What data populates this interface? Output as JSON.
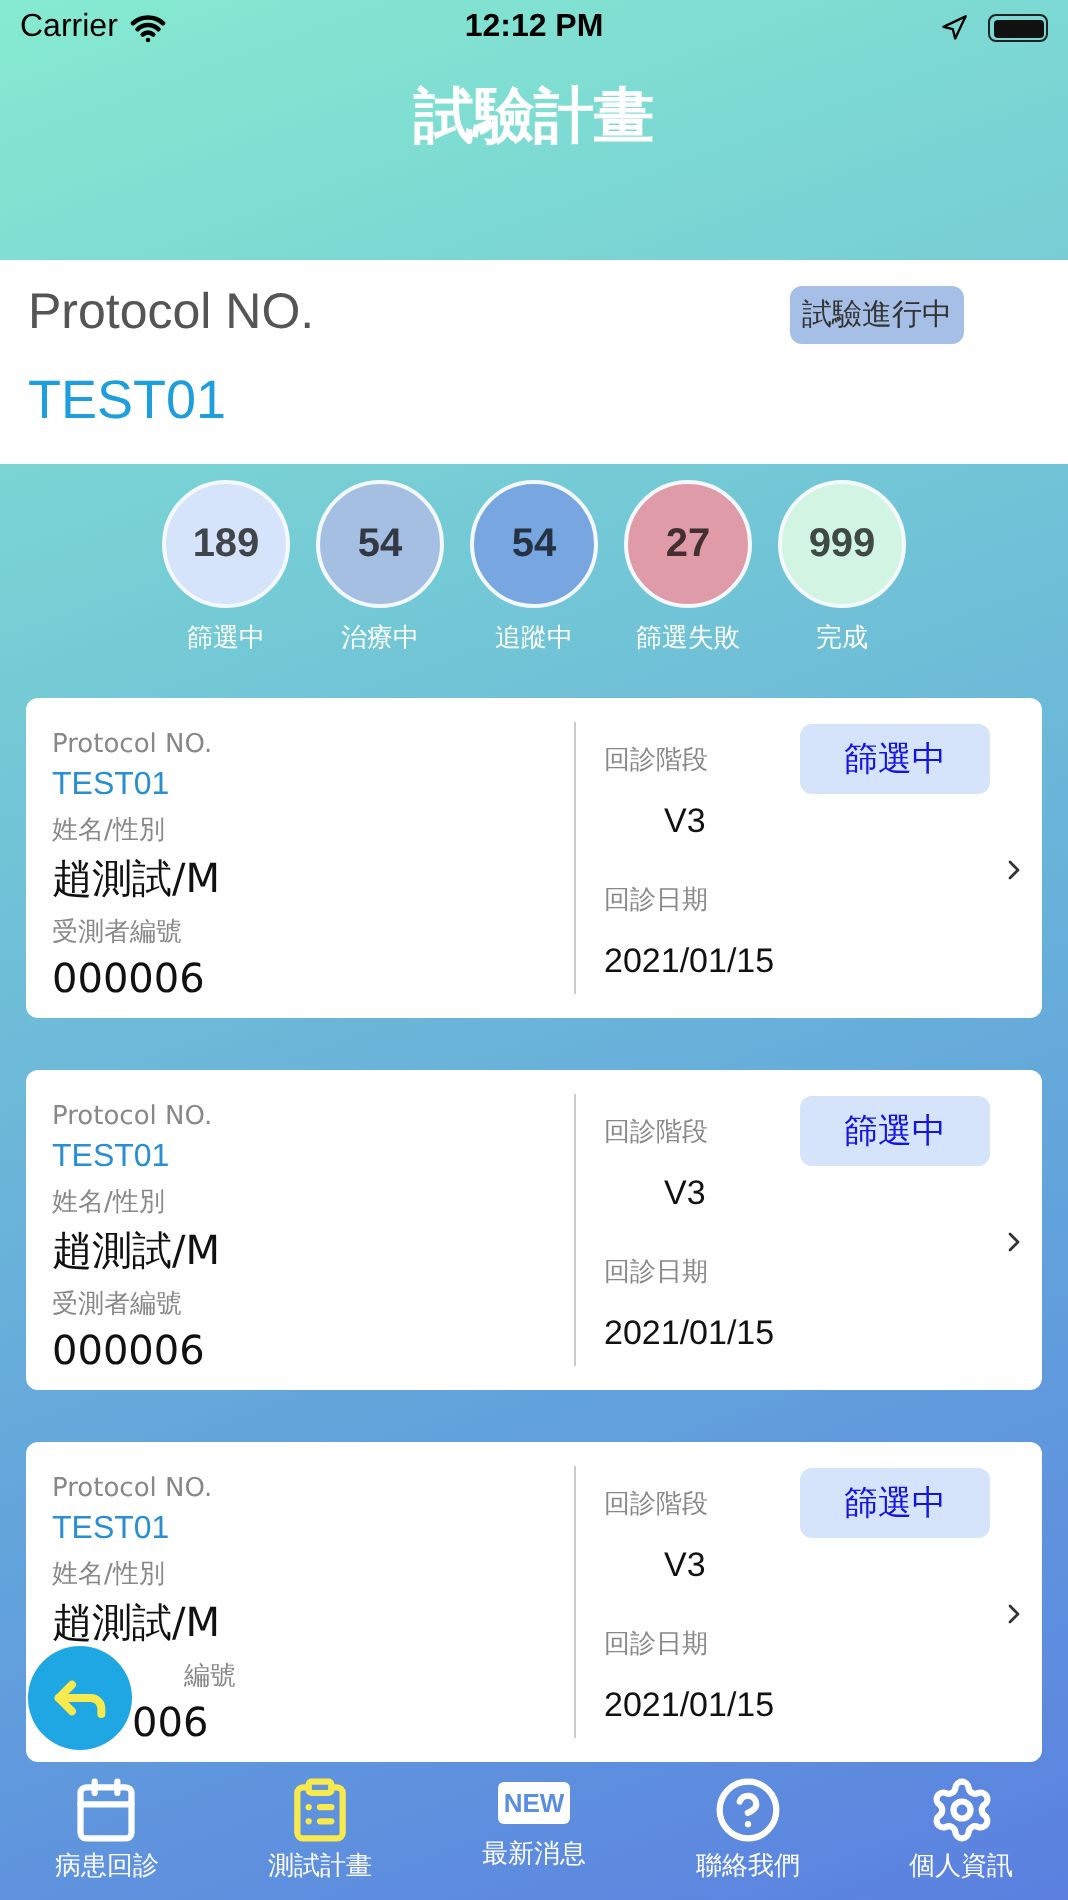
{
  "status_bar": {
    "carrier": "Carrier",
    "time": "12:12 PM"
  },
  "title": "試驗計畫",
  "protocol": {
    "label": "Protocol NO.",
    "value": "TEST01",
    "status": "試驗進行中"
  },
  "counters": [
    {
      "count": "189",
      "label": "篩選中",
      "color": "#d6e4fb"
    },
    {
      "count": "54",
      "label": "治療中",
      "color": "#a5bfe3"
    },
    {
      "count": "54",
      "label": "追蹤中",
      "color": "#77a6e0"
    },
    {
      "count": "27",
      "label": "篩選失敗",
      "color": "#e09ba8"
    },
    {
      "count": "999",
      "label": "完成",
      "color": "#d2f5e3"
    }
  ],
  "cards": [
    {
      "kind": "full",
      "protocol_label": "Protocol NO.",
      "protocol": "TEST01",
      "name_label": "姓名/性別",
      "name": "趙測試/M",
      "id_label": "受測者編號",
      "id": "000006",
      "stage_label": "回診階段",
      "stage": "V3",
      "date_label": "回診日期",
      "date": "2021/01/15",
      "status": "篩選中"
    },
    {
      "kind": "full",
      "protocol_label": "Protocol NO.",
      "protocol": "TEST01",
      "name_label": "姓名/性別",
      "name": "趙測試/M",
      "id_label": "受測者編號",
      "id": "000006",
      "stage_label": "回診階段",
      "stage": "V3",
      "date_label": "回診日期",
      "date": "2021/01/15",
      "status": "篩選中"
    },
    {
      "kind": "covered",
      "protocol_label": "Protocol NO.",
      "protocol": "TEST01",
      "name_label": "姓名/性別",
      "name": "趙測試/M",
      "id_label": "編號",
      "id": "006",
      "stage_label": "回診階段",
      "stage": "V3",
      "date_label": "回診日期",
      "date": "2021/01/15",
      "status": "篩選中"
    }
  ],
  "tab_bar": [
    {
      "kind": "calendar",
      "label": "病患回診",
      "selected": false
    },
    {
      "kind": "clipboard",
      "label": "測試計畫",
      "selected": true
    },
    {
      "kind": "new",
      "label": "最新消息",
      "badge": "NEW",
      "selected": false
    },
    {
      "kind": "help",
      "label": "聯絡我們",
      "selected": false
    },
    {
      "kind": "settings",
      "label": "個人資訊",
      "selected": false
    }
  ]
}
